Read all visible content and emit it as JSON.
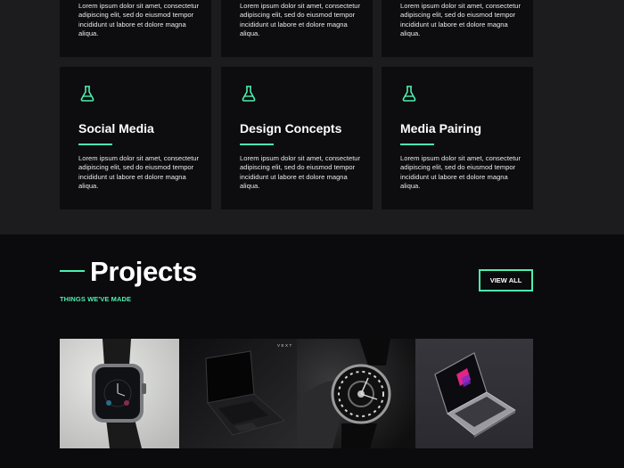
{
  "services": {
    "cards": [
      {
        "title": "",
        "desc": "Lorem ipsum dolor sit amet, consectetur adipiscing elit, sed do eiusmod tempor incididunt ut labore et dolore magna aliqua."
      },
      {
        "title": "",
        "desc": "Lorem ipsum dolor sit amet, consectetur adipiscing elit, sed do eiusmod tempor incididunt ut labore et dolore magna aliqua."
      },
      {
        "title": "",
        "desc": "Lorem ipsum dolor sit amet, consectetur adipiscing elit, sed do eiusmod tempor incididunt ut labore et dolore magna aliqua."
      },
      {
        "title": "Social Media",
        "icon": "flask-icon",
        "desc": "Lorem ipsum dolor sit amet, consectetur adipiscing elit, sed do eiusmod tempor incididunt ut labore et dolore magna aliqua."
      },
      {
        "title": "Design Concepts",
        "icon": "flask-icon",
        "desc": "Lorem ipsum dolor sit amet, consectetur adipiscing elit, sed do eiusmod tempor incididunt ut labore et dolore magna aliqua."
      },
      {
        "title": "Media Pairing",
        "icon": "flask-icon",
        "desc": "Lorem ipsum dolor sit amet, consectetur adipiscing elit, sed do eiusmod tempor incididunt ut labore et dolore magna aliqua."
      }
    ]
  },
  "projects": {
    "title": "Projects",
    "subtitle": "THINGS WE'VE MADE",
    "view_all_label": "VIEW ALL",
    "brand_text": "VEXT",
    "images": [
      "smartwatch-photo",
      "laptop-photo",
      "wristwatch-photo",
      "laptop-photo"
    ]
  },
  "colors": {
    "accent": "#4cf0b0",
    "background": "#0b0a0c",
    "section_background": "#1c1b1e",
    "card_background": "#0d0c0e"
  }
}
